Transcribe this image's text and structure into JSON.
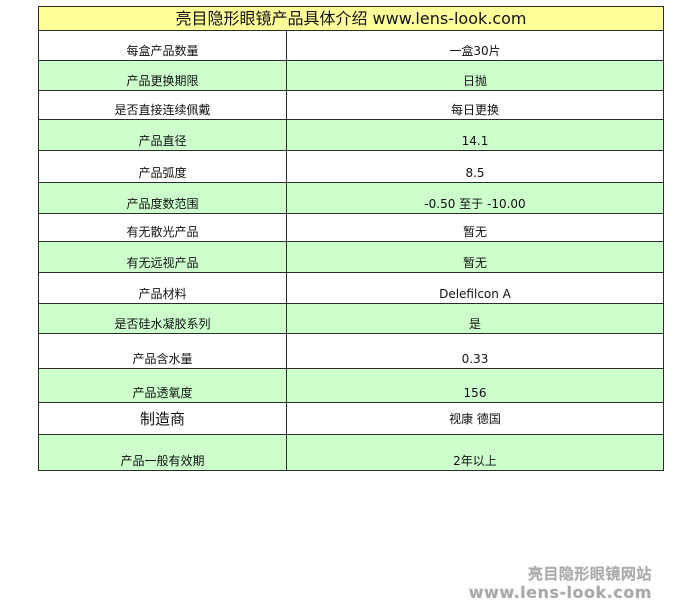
{
  "table": {
    "title": "亮目隐形眼镜产品具体介绍  www.lens-look.com",
    "rows": [
      {
        "label": "每盒产品数量",
        "value": "一盒30片"
      },
      {
        "label": "产品更换期限",
        "value": "日抛"
      },
      {
        "label": "是否直接连续佩戴",
        "value": "每日更换"
      },
      {
        "label": "产品直径",
        "value": "14.1"
      },
      {
        "label": "产品弧度",
        "value": "8.5"
      },
      {
        "label": "产品度数范围",
        "value": "-0.50 至于 -10.00"
      },
      {
        "label": "有无散光产品",
        "value": "暂无"
      },
      {
        "label": "有无远视产品",
        "value": "暂无"
      },
      {
        "label": "产品材料",
        "value": "Delefilcon A"
      },
      {
        "label": "是否硅水凝胶系列",
        "value": "是"
      },
      {
        "label": "产品含水量",
        "value": "0.33"
      },
      {
        "label": "产品透氧度",
        "value": "156"
      },
      {
        "label": "制造商",
        "value": "视康  德国"
      },
      {
        "label": "产品一般有效期",
        "value": "2年以上"
      }
    ]
  },
  "watermark": {
    "name": "亮目隐形眼镜网站",
    "url": "www.lens-look.com"
  },
  "colors": {
    "title_bg": "#ffff99",
    "green_row_bg": "#ccffcc",
    "white_row_bg": "#ffffff",
    "border": "#2b2b2b"
  }
}
